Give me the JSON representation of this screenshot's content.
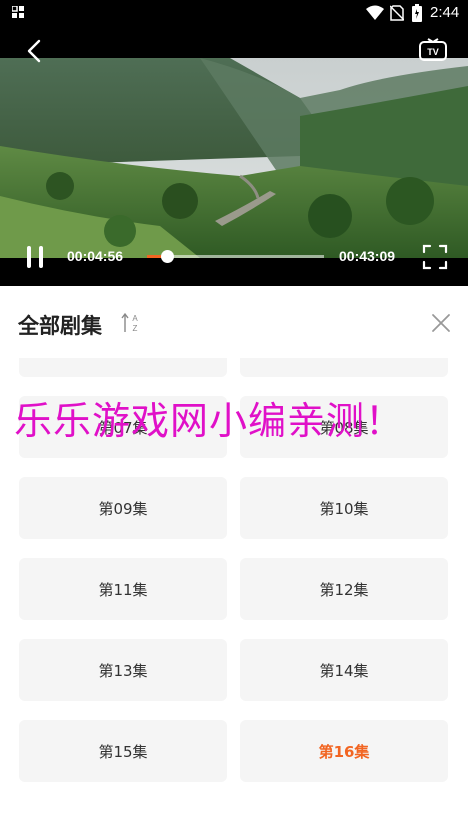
{
  "status_bar": {
    "time": "2:44",
    "icons": [
      "notification-icon",
      "wifi-icon",
      "no-sim-icon",
      "battery-icon"
    ]
  },
  "player": {
    "current_time": "00:04:56",
    "total_time": "00:43:09",
    "progress_fraction": 0.114,
    "icons": [
      "back-icon",
      "tv-cast-icon",
      "pause-icon",
      "fullscreen-icon"
    ],
    "accent_color": "#f26522"
  },
  "panel": {
    "title": "全部剧集",
    "sort_icon": "sort-az-icon",
    "close_icon": "close-icon"
  },
  "episodes": [
    {
      "label": "",
      "active": false
    },
    {
      "label": "",
      "active": false
    },
    {
      "label": "第07集",
      "active": false
    },
    {
      "label": "第08集",
      "active": false
    },
    {
      "label": "第09集",
      "active": false
    },
    {
      "label": "第10集",
      "active": false
    },
    {
      "label": "第11集",
      "active": false
    },
    {
      "label": "第12集",
      "active": false
    },
    {
      "label": "第13集",
      "active": false
    },
    {
      "label": "第14集",
      "active": false
    },
    {
      "label": "第15集",
      "active": false
    },
    {
      "label": "第16集",
      "active": true
    }
  ],
  "watermark": "乐乐游戏网小编亲测！"
}
